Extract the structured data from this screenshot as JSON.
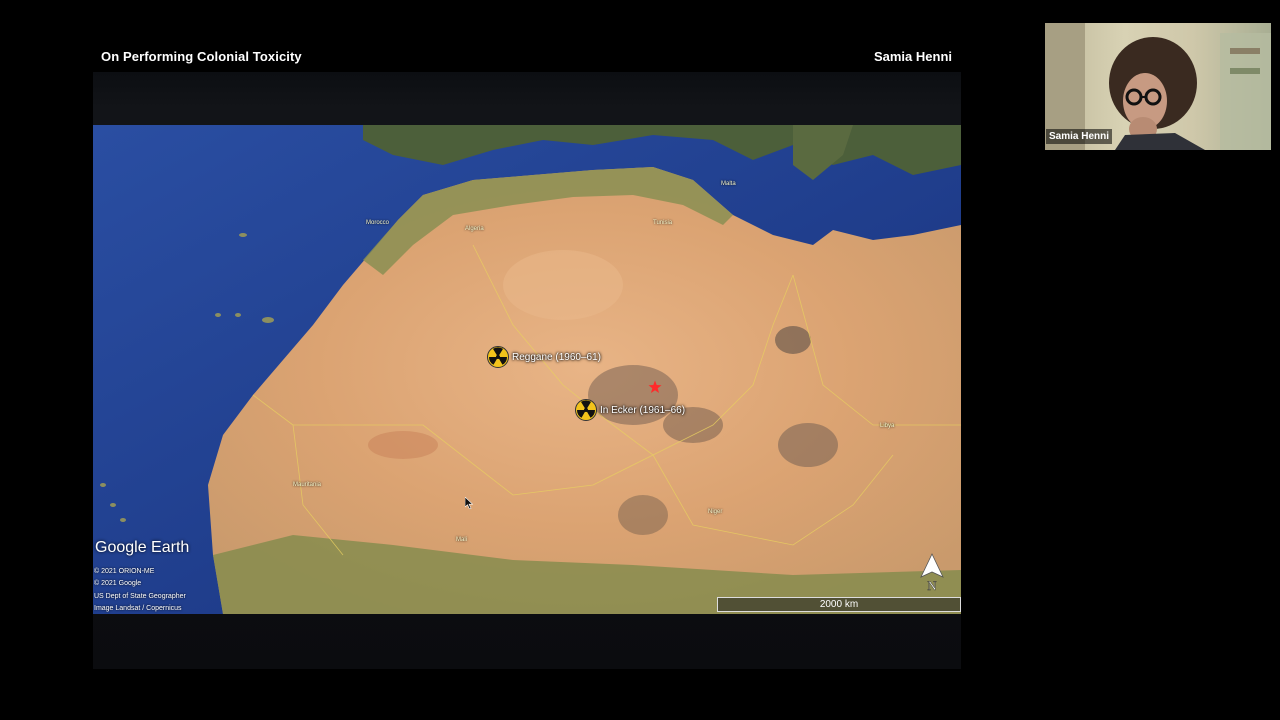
{
  "slide": {
    "title": "On Performing Colonial Toxicity",
    "author": "Samia Henni"
  },
  "map": {
    "sites": [
      {
        "label": "Reggane (1960–61)",
        "icon": "radiation-icon"
      },
      {
        "label": "In Ecker (1961–66)",
        "icon": "radiation-icon"
      }
    ],
    "places": {
      "algeria": "Algeria",
      "libya": "Libya",
      "mali": "Mali",
      "mauritania": "Mauritania",
      "morocco": "Morocco",
      "niger": "Niger",
      "malta": "Malta",
      "tunisia": "Tunisia"
    },
    "logo": "Google Earth",
    "attribution": [
      "© 2021 ORION-ME",
      "© 2021 Google",
      "US Dept of State Geographer",
      "Image Landsat / Copernicus"
    ],
    "scale": "2000 km",
    "compass_label": "N",
    "colors": {
      "ocean": "#1c3b87",
      "desert": "#e0a878",
      "marker": "#ff2a2a"
    }
  },
  "video": {
    "participant_name": "Samia Henni"
  }
}
